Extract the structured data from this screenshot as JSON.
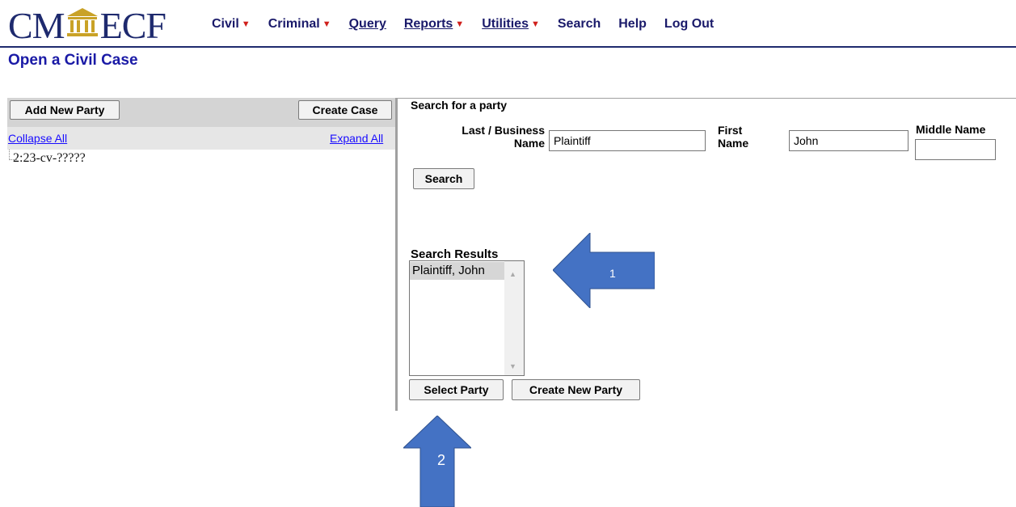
{
  "header": {
    "logo_left": "CM",
    "logo_right": "ECF",
    "menu": [
      {
        "label": "Civil",
        "has_dropdown": true
      },
      {
        "label": "Criminal",
        "has_dropdown": true
      },
      {
        "label": "Query",
        "has_dropdown": false
      },
      {
        "label": "Reports",
        "has_dropdown": true
      },
      {
        "label": "Utilities",
        "has_dropdown": true
      },
      {
        "label": "Search",
        "has_dropdown": false
      },
      {
        "label": "Help",
        "has_dropdown": false
      },
      {
        "label": "Log Out",
        "has_dropdown": false
      }
    ]
  },
  "page": {
    "title": "Open a Civil Case"
  },
  "left_panel": {
    "add_party_label": "Add New Party",
    "create_case_label": "Create Case",
    "collapse_label": "Collapse All",
    "expand_label": "Expand All",
    "tree_node": "2:23-cv-?????"
  },
  "search": {
    "heading": "Search for a party",
    "last_label_1": "Last / Business",
    "last_label_2": "Name",
    "last_value": "Plaintiff",
    "first_label_1": "First",
    "first_label_2": "Name",
    "first_value": "John",
    "middle_label": "Middle Name",
    "middle_value": "",
    "search_button": "Search"
  },
  "results": {
    "label": "Search Results",
    "items": [
      "Plaintiff, John"
    ],
    "select_button": "Select Party",
    "create_button": "Create New Party"
  },
  "annotations": {
    "arrow1_label": "1",
    "arrow2_label": "2",
    "arrow_color": "#4472c4"
  },
  "colors": {
    "brand": "#1e2a6e",
    "title": "#1a1aa6",
    "link": "#1a0dff",
    "caret": "#d0201c"
  }
}
